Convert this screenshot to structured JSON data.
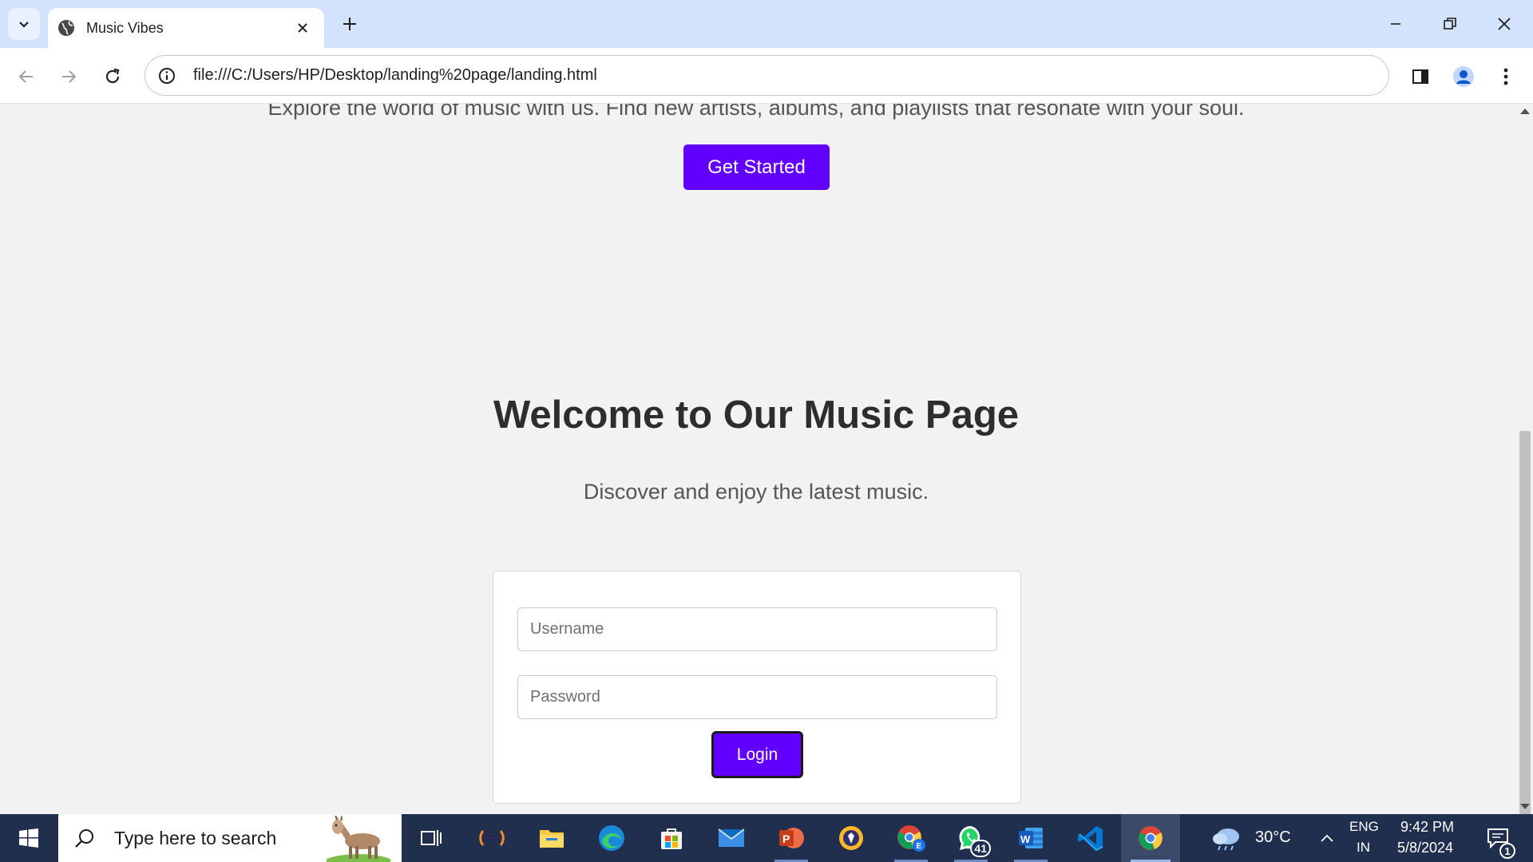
{
  "browser": {
    "tab_title": "Music Vibes",
    "url": "file:///C:/Users/HP/Desktop/landing%20page/landing.html"
  },
  "page": {
    "cut_off_text": "Explore the world of music with us. Find new artists, albums, and playlists that resonate with your soul.",
    "get_started_label": "Get Started",
    "welcome_heading": "Welcome to Our Music Page",
    "tagline": "Discover and enjoy the latest music.",
    "login": {
      "username_placeholder": "Username",
      "password_placeholder": "Password",
      "button_label": "Login"
    }
  },
  "taskbar": {
    "search_placeholder": "Type here to search",
    "apps": [
      "task-view",
      "eclipse",
      "file-explorer",
      "edge",
      "microsoft-store",
      "mail",
      "powerpoint",
      "brave",
      "chrome-profile",
      "whatsapp",
      "word",
      "vs-code",
      "chrome"
    ],
    "whatsapp_badge": "41",
    "weather": "30°C",
    "language": "ENG",
    "region": "IN",
    "time": "9:42 PM",
    "date": "5/8/2024",
    "notification_count": "1"
  },
  "colors": {
    "accent": "#6200ff",
    "tabstrip": "#d3e3fd",
    "taskbar": "#1f2f4d",
    "page_bg": "#f2f2f2"
  }
}
